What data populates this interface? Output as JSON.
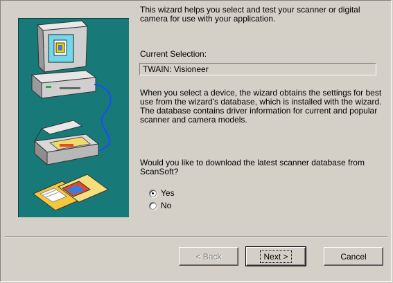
{
  "intro_text": "This wizard helps you select and test your scanner or digital camera for use with your application.",
  "current_selection": {
    "label": "Current Selection:",
    "value": "TWAIN: Visioneer"
  },
  "description_text": "When you select a device, the wizard obtains the settings for best use from the wizard's database, which is installed with the wizard. The database contains driver information for current and popular scanner and camera models.",
  "question_text": "Would you like to download the latest scanner database from ScanSoft?",
  "options": [
    {
      "label": "Yes",
      "selected": true
    },
    {
      "label": "No",
      "selected": false
    }
  ],
  "buttons": {
    "back": "< Back",
    "next": "Next >",
    "cancel": "Cancel"
  },
  "colors": {
    "dialog": "#d4d0c8",
    "art_background": "#177a78"
  }
}
